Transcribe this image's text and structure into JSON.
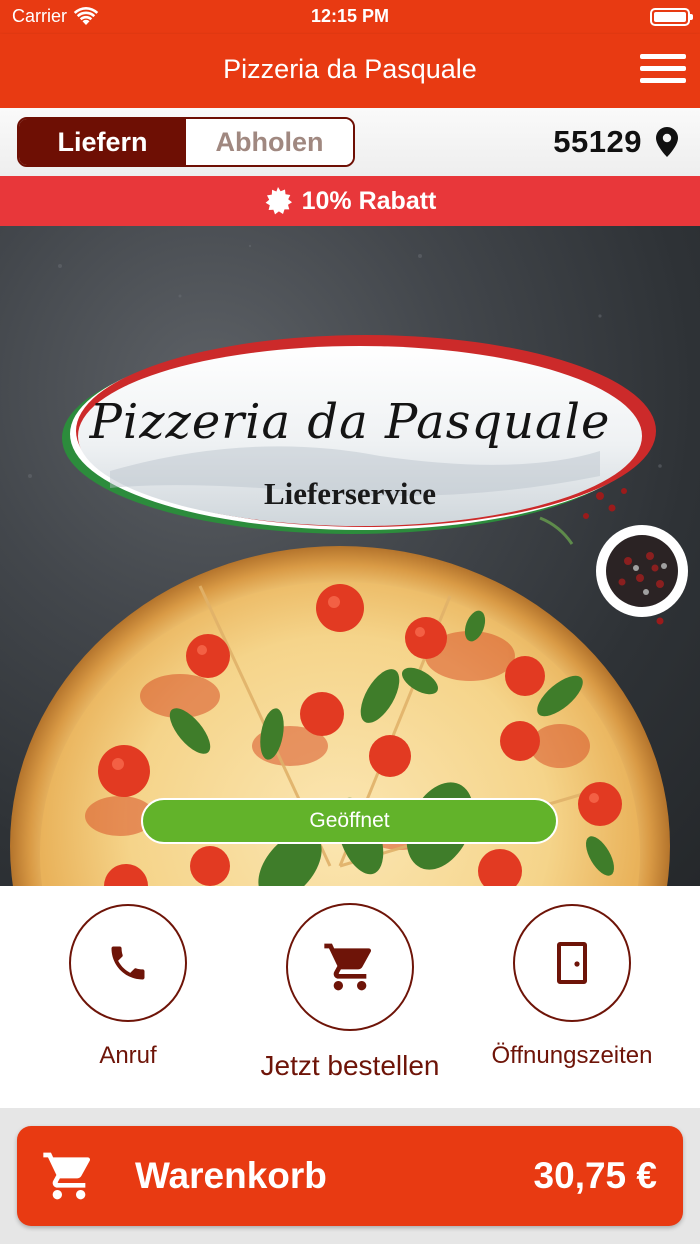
{
  "status_bar": {
    "carrier": "Carrier",
    "time": "12:15 PM",
    "icons": [
      "wifi-icon",
      "battery-icon"
    ]
  },
  "nav": {
    "title": "Pizzeria da Pasquale",
    "menu_icon": "hamburger-menu-icon"
  },
  "order_mode": {
    "options": [
      "Liefern",
      "Abholen"
    ],
    "selected": "Liefern"
  },
  "location": {
    "postcode": "55129",
    "icon": "location-pin-icon"
  },
  "discount": {
    "text": "10% Rabatt",
    "icon": "badge-icon"
  },
  "hero": {
    "logo_title": "Pizzeria da Pasquale",
    "logo_subtitle": "Lieferservice",
    "open_status": "Geöffnet"
  },
  "actions": [
    {
      "label": "Anruf",
      "icon": "phone-icon"
    },
    {
      "label": "Jetzt bestellen",
      "icon": "cart-icon"
    },
    {
      "label": "Öffnungszeiten",
      "icon": "door-icon"
    }
  ],
  "cart": {
    "label": "Warenkorb",
    "total": "30,75 €",
    "icon": "cart-icon"
  },
  "colors": {
    "primary": "#e83a12",
    "dark_red": "#6e0f04",
    "discount_red": "#e8373a",
    "open_green": "#62b32a"
  }
}
